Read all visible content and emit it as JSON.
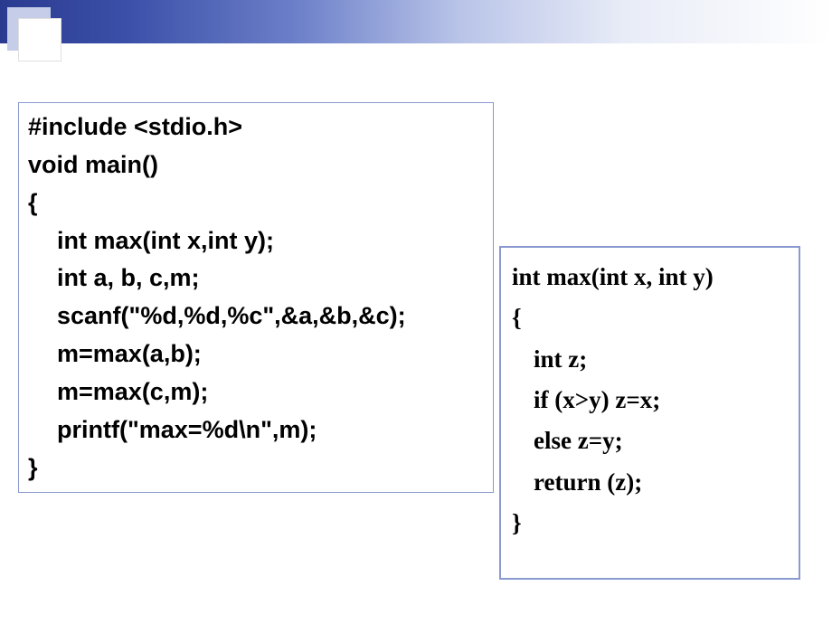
{
  "leftCode": {
    "l1": "#include <stdio.h>",
    "l2": "void main()",
    "l3": "{",
    "l4": "int max(int x,int y);",
    "l5": "int a, b, c,m;",
    "l6": "scanf(\"%d,%d,%c\",&a,&b,&c);",
    "l7": "m=max(a,b);",
    "l8": "m=max(c,m);",
    "l9": "printf(\"max=%d\\n\",m);",
    "l10": "}"
  },
  "rightCode": {
    "r1": "int  max(int x, int y)",
    "r2": "{",
    "r3": "int z;",
    "r4": "if  (x>y)  z=x;",
    "r5": "else z=y;",
    "r6": "return (z);",
    "r7": "}"
  }
}
